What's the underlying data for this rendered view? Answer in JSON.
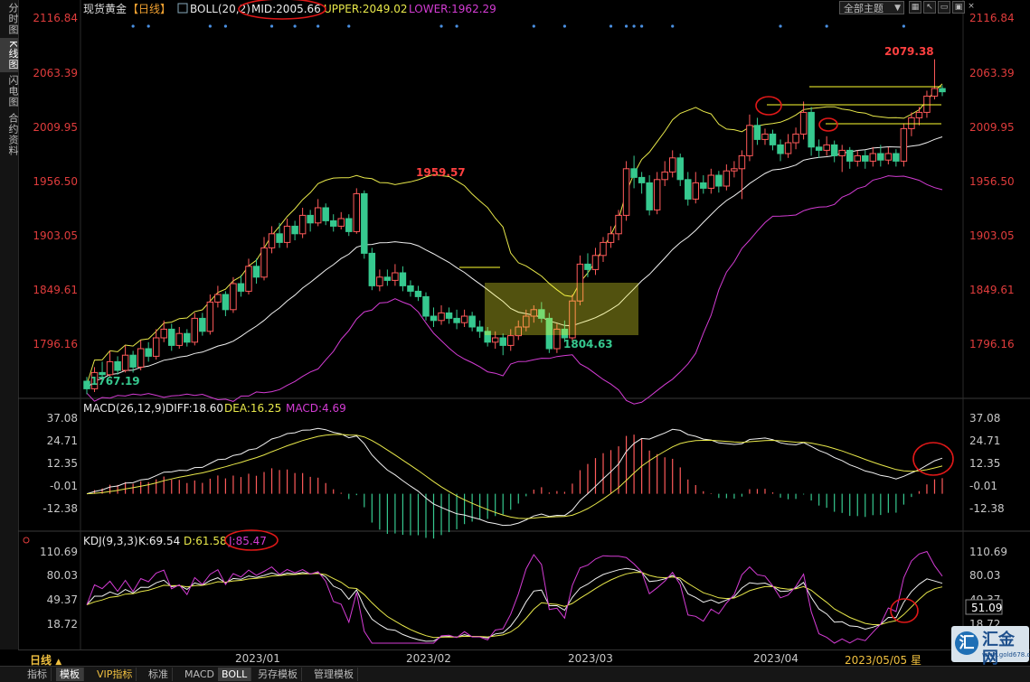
{
  "sidebar": {
    "items": [
      {
        "label": "分时图",
        "active": false
      },
      {
        "label": "K线图",
        "active": true
      },
      {
        "label": "闪电图",
        "active": false
      },
      {
        "label": "合约资料",
        "active": false
      }
    ]
  },
  "header": {
    "symbol": "现货黄金",
    "period_tag": "【日线】",
    "boll_label": "BOLL(20,2)",
    "boll_mid": "MID:2005.66",
    "boll_upper": "UPPER:2049.02",
    "boll_lower": "LOWER:1962.29",
    "theme_label": "全部主题",
    "theme_arrow": "▼",
    "window_icons": [
      "grid-icon",
      "arrow-icon",
      "minimize-icon",
      "restore-icon",
      "close-icon"
    ]
  },
  "main": {
    "price_ticks": [
      "2116.84",
      "2063.39",
      "2009.95",
      "1956.50",
      "1903.05",
      "1849.61",
      "1796.16"
    ],
    "annotations": {
      "high": "2079.38",
      "feb_high": "1959.57",
      "march_low": "1804.63",
      "low": "1767.19"
    }
  },
  "macd": {
    "label": "MACD(26,12,9)",
    "diff": "DIFF:18.60",
    "dea": "DEA:16.25",
    "macd": "MACD:4.69",
    "ticks": [
      "37.08",
      "24.71",
      "12.35",
      "-0.01",
      "-12.38"
    ]
  },
  "kdj": {
    "label": "KDJ(9,3,3)",
    "k": "K:69.54",
    "d": "D:61.58",
    "j": "J:85.47",
    "ticks": [
      "110.69",
      "80.03",
      "49.37",
      "18.72"
    ],
    "cursor_value": "51.09"
  },
  "timeaxis": {
    "period_label": "日线",
    "period_arrow": "▲",
    "months": [
      "2023/01",
      "2023/02",
      "2023/03",
      "2023/04"
    ],
    "cursor_date": "2023/05/05 星"
  },
  "bottom_tabs": [
    {
      "label": "指标",
      "active": false
    },
    {
      "label": "模板",
      "active": true
    },
    {
      "label": "VIP指标",
      "active": false
    },
    {
      "label": "标准",
      "active": false
    },
    {
      "label": "MACD",
      "active": false
    },
    {
      "label": "BOLL",
      "active": true
    },
    {
      "label": "另存模板",
      "active": false
    },
    {
      "label": "管理模板",
      "active": false
    }
  ],
  "brand": {
    "mark": "汇",
    "name": "汇金网",
    "url": "www.gold678.com"
  },
  "colors": {
    "bg": "#000000",
    "up": "#ff5a5a",
    "down": "#36c98f",
    "price_axis": "#e03c3c",
    "mid": "#f0f0f0",
    "upper": "#e8e84a",
    "lower": "#d43cd4",
    "highlight": "#ffff30",
    "annotation_circle": "#e01818",
    "date_marker": "#4a90e2"
  },
  "chart_data": [
    {
      "type": "candlestick",
      "title": "现货黄金【日线】",
      "ylim": [
        1767,
        2117
      ],
      "xlabels": [
        "2023/01",
        "2023/02",
        "2023/03",
        "2023/04"
      ],
      "candles": [
        [
          1782,
          1775,
          1786,
          1770
        ],
        [
          1775,
          1790,
          1795,
          1772
        ],
        [
          1790,
          1788,
          1800,
          1785
        ],
        [
          1788,
          1800,
          1810,
          1786
        ],
        [
          1800,
          1792,
          1805,
          1788
        ],
        [
          1792,
          1806,
          1815,
          1790
        ],
        [
          1806,
          1795,
          1810,
          1790
        ],
        [
          1795,
          1812,
          1820,
          1792
        ],
        [
          1812,
          1805,
          1818,
          1800
        ],
        [
          1805,
          1822,
          1830,
          1802
        ],
        [
          1822,
          1830,
          1838,
          1818
        ],
        [
          1830,
          1815,
          1835,
          1810
        ],
        [
          1815,
          1826,
          1832,
          1812
        ],
        [
          1826,
          1818,
          1830,
          1814
        ],
        [
          1818,
          1840,
          1845,
          1815
        ],
        [
          1840,
          1828,
          1845,
          1824
        ],
        [
          1828,
          1855,
          1862,
          1825
        ],
        [
          1855,
          1862,
          1870,
          1850
        ],
        [
          1862,
          1848,
          1865,
          1842
        ],
        [
          1848,
          1872,
          1878,
          1845
        ],
        [
          1872,
          1865,
          1880,
          1860
        ],
        [
          1865,
          1888,
          1895,
          1862
        ],
        [
          1888,
          1878,
          1895,
          1872
        ],
        [
          1878,
          1905,
          1915,
          1875
        ],
        [
          1905,
          1918,
          1925,
          1900
        ],
        [
          1918,
          1910,
          1928,
          1905
        ],
        [
          1910,
          1925,
          1932,
          1905
        ],
        [
          1925,
          1918,
          1930,
          1912
        ],
        [
          1918,
          1935,
          1942,
          1914
        ],
        [
          1935,
          1928,
          1940,
          1920
        ],
        [
          1928,
          1942,
          1950,
          1925
        ],
        [
          1942,
          1930,
          1946,
          1926
        ],
        [
          1930,
          1925,
          1936,
          1920
        ],
        [
          1925,
          1932,
          1938,
          1922
        ],
        [
          1932,
          1920,
          1936,
          1916
        ],
        [
          1920,
          1955,
          1960,
          1918
        ],
        [
          1955,
          1900,
          1958,
          1895
        ],
        [
          1900,
          1870,
          1905,
          1866
        ],
        [
          1870,
          1878,
          1885,
          1865
        ],
        [
          1878,
          1875,
          1885,
          1870
        ],
        [
          1875,
          1882,
          1890,
          1870
        ],
        [
          1882,
          1870,
          1888,
          1865
        ],
        [
          1870,
          1865,
          1875,
          1860
        ],
        [
          1865,
          1860,
          1870,
          1856
        ],
        [
          1860,
          1842,
          1864,
          1838
        ],
        [
          1842,
          1838,
          1850,
          1832
        ],
        [
          1838,
          1845,
          1852,
          1834
        ],
        [
          1845,
          1840,
          1850,
          1835
        ],
        [
          1840,
          1836,
          1848,
          1830
        ],
        [
          1836,
          1842,
          1848,
          1832
        ],
        [
          1842,
          1832,
          1846,
          1828
        ],
        [
          1832,
          1828,
          1838,
          1822
        ],
        [
          1828,
          1818,
          1832,
          1814
        ],
        [
          1818,
          1822,
          1828,
          1812
        ],
        [
          1822,
          1815,
          1826,
          1806
        ],
        [
          1815,
          1824,
          1830,
          1810
        ],
        [
          1824,
          1832,
          1838,
          1820
        ],
        [
          1832,
          1842,
          1848,
          1828
        ],
        [
          1842,
          1848,
          1852,
          1836
        ],
        [
          1848,
          1840,
          1855,
          1836
        ],
        [
          1840,
          1812,
          1845,
          1808
        ],
        [
          1812,
          1830,
          1835,
          1808
        ],
        [
          1830,
          1822,
          1838,
          1818
        ],
        [
          1822,
          1856,
          1862,
          1818
        ],
        [
          1856,
          1890,
          1898,
          1852
        ],
        [
          1890,
          1885,
          1900,
          1878
        ],
        [
          1885,
          1898,
          1905,
          1880
        ],
        [
          1898,
          1910,
          1915,
          1892
        ],
        [
          1910,
          1918,
          1925,
          1905
        ],
        [
          1918,
          1935,
          1940,
          1912
        ],
        [
          1935,
          1978,
          1985,
          1930
        ],
        [
          1978,
          1970,
          1990,
          1960
        ],
        [
          1970,
          1965,
          1975,
          1955
        ],
        [
          1965,
          1940,
          1972,
          1935
        ],
        [
          1940,
          1968,
          1975,
          1936
        ],
        [
          1968,
          1975,
          1985,
          1962
        ],
        [
          1975,
          1988,
          1995,
          1970
        ],
        [
          1988,
          1968,
          1992,
          1962
        ],
        [
          1968,
          1950,
          1975,
          1944
        ],
        [
          1950,
          1965,
          1975,
          1946
        ],
        [
          1965,
          1960,
          1972,
          1955
        ],
        [
          1960,
          1972,
          1978,
          1955
        ],
        [
          1972,
          1962,
          1976,
          1956
        ],
        [
          1962,
          1976,
          1982,
          1958
        ],
        [
          1976,
          1978,
          1985,
          1970
        ],
        [
          1978,
          1990,
          1995,
          1950
        ],
        [
          1990,
          2018,
          2028,
          1985
        ],
        [
          2018,
          2005,
          2025,
          2000
        ],
        [
          2005,
          2010,
          2015,
          2000
        ],
        [
          2010,
          2000,
          2014,
          1995
        ],
        [
          2000,
          1992,
          2005,
          1985
        ],
        [
          1992,
          2002,
          2010,
          1988
        ],
        [
          2002,
          2010,
          2016,
          1996
        ],
        [
          2010,
          2030,
          2040,
          2005
        ],
        [
          2030,
          1998,
          2035,
          1990
        ],
        [
          1998,
          1995,
          2005,
          1988
        ],
        [
          1995,
          2000,
          2008,
          1990
        ],
        [
          2000,
          1990,
          2004,
          1984
        ],
        [
          1990,
          1995,
          2000,
          1975
        ],
        [
          1995,
          1985,
          1998,
          1978
        ],
        [
          1985,
          1990,
          1995,
          1980
        ],
        [
          1990,
          1985,
          1995,
          1978
        ],
        [
          1985,
          1992,
          1998,
          1980
        ],
        [
          1992,
          1986,
          2000,
          1980
        ],
        [
          1986,
          1992,
          1998,
          1982
        ],
        [
          1992,
          1985,
          1996,
          1980
        ],
        [
          1985,
          2015,
          2020,
          1980
        ],
        [
          2015,
          2025,
          2030,
          2008
        ],
        [
          2025,
          2030,
          2035,
          2018
        ],
        [
          2030,
          2045,
          2050,
          2025
        ],
        [
          2045,
          2052,
          2079,
          2042
        ],
        [
          2052,
          2049,
          2055,
          2045
        ]
      ],
      "bollinger": {
        "mid": 2005.66,
        "upper": 2049.02,
        "lower": 1962.29
      }
    },
    {
      "type": "bar",
      "title": "MACD(26,12,9)",
      "ylim": [
        -17,
        40
      ],
      "series": [
        {
          "name": "DIFF",
          "last": 18.6
        },
        {
          "name": "DEA",
          "last": 16.25
        },
        {
          "name": "MACD",
          "last": 4.69
        }
      ]
    },
    {
      "type": "line",
      "title": "KDJ(9,3,3)",
      "ylim": [
        5,
        115
      ],
      "series": [
        {
          "name": "K",
          "last": 69.54
        },
        {
          "name": "D",
          "last": 61.58
        },
        {
          "name": "J",
          "last": 85.47
        }
      ]
    }
  ]
}
